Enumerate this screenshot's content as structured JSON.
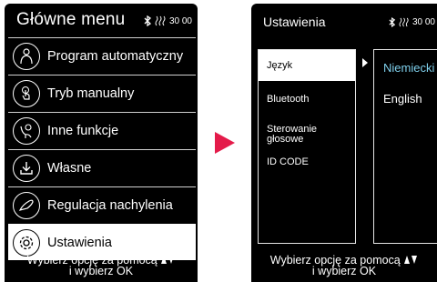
{
  "main_menu": {
    "title": "Główne menu",
    "status_text": "30 00",
    "items": [
      {
        "label": "Program automatyczny",
        "icon": "body-outline-icon"
      },
      {
        "label": "Tryb manualny",
        "icon": "hand-touch-icon"
      },
      {
        "label": "Inne funkcje",
        "icon": "massage-hand-icon"
      },
      {
        "label": "Własne",
        "icon": "download-icon"
      },
      {
        "label": "Regulacja nachylenia",
        "icon": "recline-chair-icon"
      },
      {
        "label": "Ustawienia",
        "icon": "gear-icon",
        "selected": true
      }
    ],
    "footer_line1": "Wybierz opcję za pomocą",
    "footer_line2": "i wybierz OK"
  },
  "settings": {
    "title": "Ustawienia",
    "status_text": "30 00",
    "items": [
      {
        "label": "Język",
        "selected": true
      },
      {
        "label": "Bluetooth"
      },
      {
        "label": "Sterowanie głosowe"
      },
      {
        "label": "ID CODE"
      }
    ],
    "languages": [
      {
        "label": "Niemiecki",
        "active": true
      },
      {
        "label": "English"
      }
    ],
    "footer_line1": "Wybierz opcję za pomocą",
    "footer_line2": "i wybierz OK"
  },
  "colors": {
    "screen_bg": "#000000",
    "highlight_bg": "#ffffff",
    "active_language": "#7fd0ec",
    "arrow": "#e41b4a"
  }
}
